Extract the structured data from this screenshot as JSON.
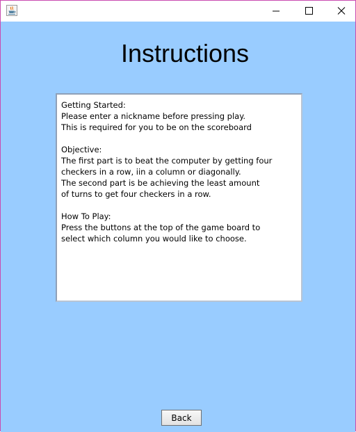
{
  "titlebar": {
    "app_icon": "java-icon",
    "minimize_icon": "minimize-icon",
    "maximize_icon": "maximize-icon",
    "close_icon": "close-icon"
  },
  "colors": {
    "background": "#99ccff",
    "panel": "#ffffff"
  },
  "heading": "Instructions",
  "instructions": {
    "lines": [
      "Getting Started:",
      "Please enter a nickname before pressing play.",
      "This is required for you to be on the scoreboard",
      "",
      "Objective:",
      "The first part is to beat the computer by getting four",
      "checkers in a row, iin a column or diagonally.",
      "The second part is be achieving the least amount",
      "of turns to get four checkers in a row.",
      "",
      "How To Play:",
      "Press the buttons at the top of the game board to",
      "select which column you would like to choose."
    ]
  },
  "back_button": {
    "label": "Back"
  }
}
